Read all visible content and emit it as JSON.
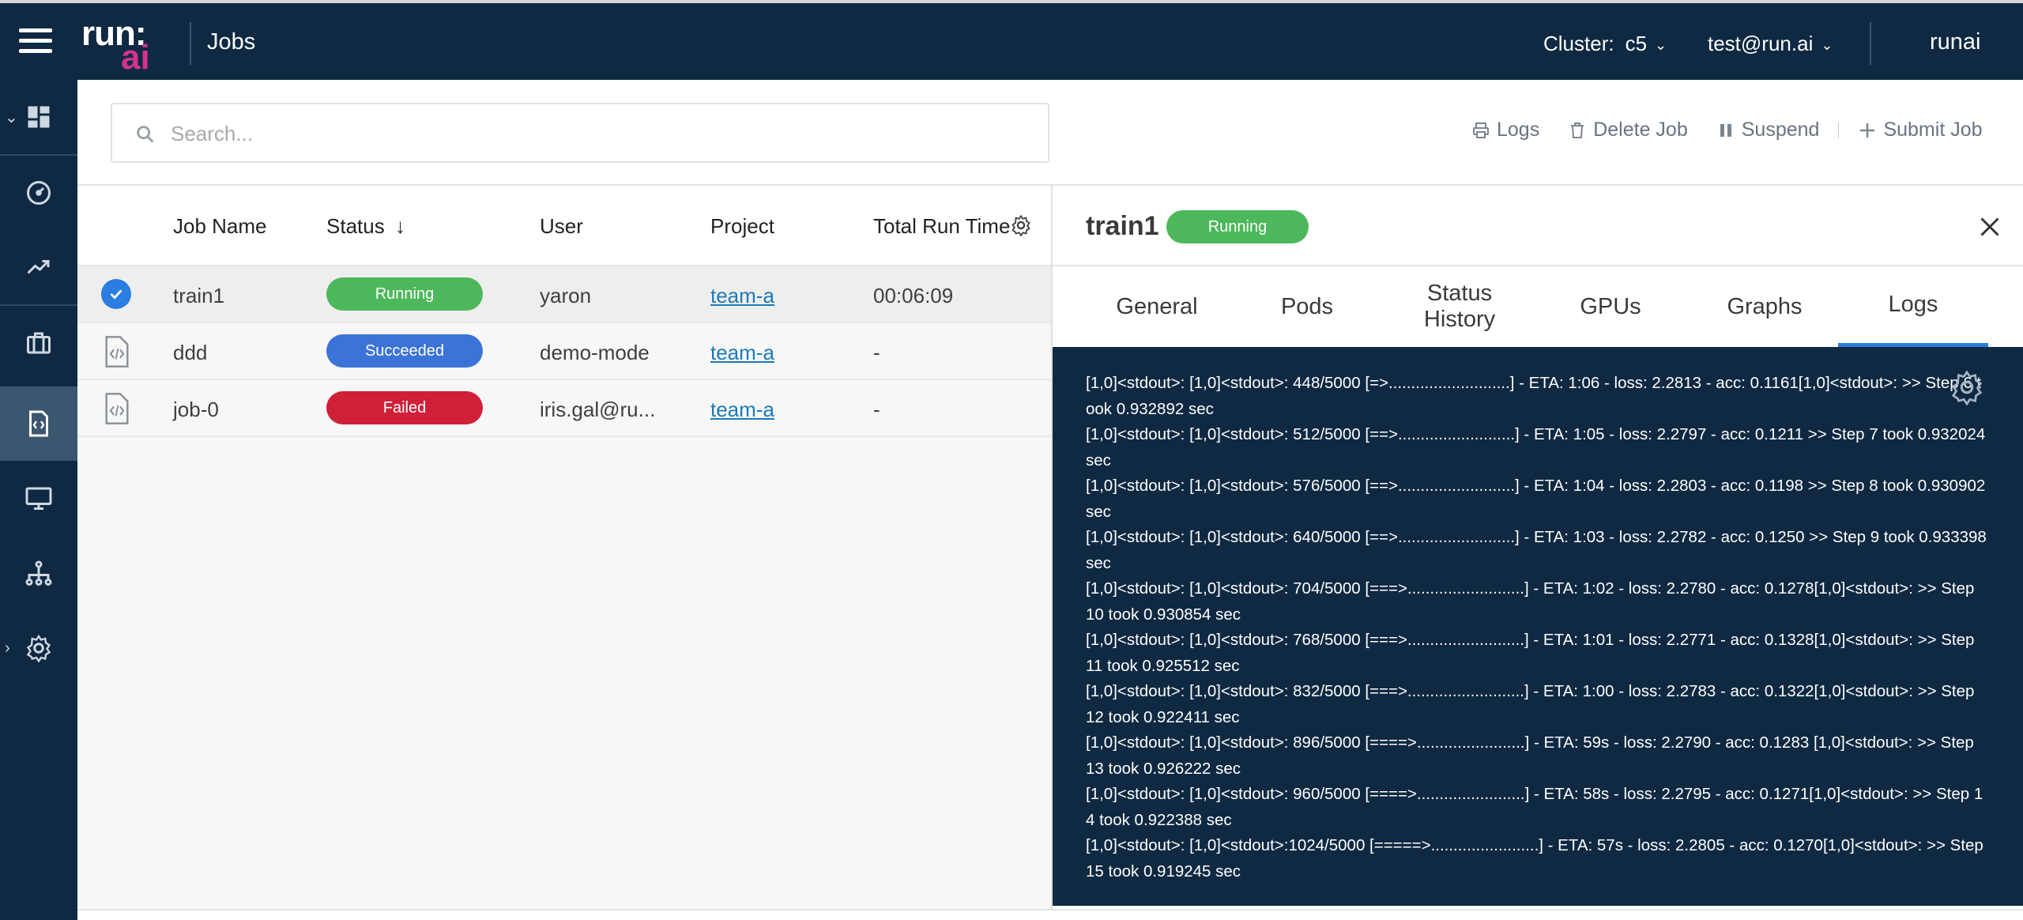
{
  "topbar": {
    "logo_top": "run:",
    "logo_bottom": "ai",
    "page_title": "Jobs",
    "cluster_label": "Cluster:",
    "cluster_value": "c5",
    "user_email": "test@run.ai",
    "tenant": "runai"
  },
  "search": {
    "placeholder": "Search..."
  },
  "actions": {
    "logs": "Logs",
    "delete": "Delete Job",
    "suspend": "Suspend",
    "submit": "Submit Job"
  },
  "table": {
    "headers": [
      "Job Name",
      "Status",
      "User",
      "Project",
      "Total Run Time"
    ],
    "rows": [
      {
        "name": "train1",
        "status": "Running",
        "user": "yaron",
        "project": "team-a",
        "runtime": "00:06:09"
      },
      {
        "name": "ddd",
        "status": "Succeeded",
        "user": "demo-mode",
        "project": "team-a",
        "runtime": "-"
      },
      {
        "name": "job-0",
        "status": "Failed",
        "user": "iris.gal@ru...",
        "project": "team-a",
        "runtime": "-"
      }
    ]
  },
  "panel": {
    "job_name": "train1",
    "status": "Running",
    "tabs": [
      "General",
      "Pods",
      "Status History",
      "GPUs",
      "Graphs",
      "Logs"
    ],
    "active_tab": "Logs",
    "logs": [
      "[1,0]<stdout>: [1,0]<stdout>: 448/5000 [=>...........................] - ETA: 1:06 - loss: 2.2813 - acc: 0.1161[1,0]<stdout>: >> Step 6 took 0.932892 sec",
      "[1,0]<stdout>: [1,0]<stdout>: 512/5000 [==>..........................] - ETA: 1:05 - loss: 2.2797 - acc: 0.1211 >> Step 7 took 0.932024 sec",
      "[1,0]<stdout>: [1,0]<stdout>: 576/5000 [==>..........................] - ETA: 1:04 - loss: 2.2803 - acc: 0.1198 >> Step 8 took 0.930902 sec",
      "[1,0]<stdout>: [1,0]<stdout>: 640/5000 [==>..........................] - ETA: 1:03 - loss: 2.2782 - acc: 0.1250 >> Step 9 took 0.933398 sec",
      "[1,0]<stdout>: [1,0]<stdout>: 704/5000 [===>..........................] - ETA: 1:02 - loss: 2.2780 - acc: 0.1278[1,0]<stdout>: >> Step 10 took 0.930854 sec",
      "[1,0]<stdout>: [1,0]<stdout>: 768/5000 [===>..........................] - ETA: 1:01 - loss: 2.2771 - acc: 0.1328[1,0]<stdout>: >> Step 11 took 0.925512 sec",
      "[1,0]<stdout>: [1,0]<stdout>: 832/5000 [===>..........................] - ETA: 1:00 - loss: 2.2783 - acc: 0.1322[1,0]<stdout>: >> Step 12 took 0.922411 sec",
      "[1,0]<stdout>: [1,0]<stdout>: 896/5000 [====>........................] - ETA: 59s - loss: 2.2790 - acc: 0.1283 [1,0]<stdout>: >> Step 13 took 0.926222 sec",
      "[1,0]<stdout>: [1,0]<stdout>: 960/5000 [====>........................] - ETA: 58s - loss: 2.2795 - acc: 0.1271[1,0]<stdout>: >> Step 14 took 0.922388 sec",
      "[1,0]<stdout>: [1,0]<stdout>:1024/5000 [=====>........................] - ETA: 57s - loss: 2.2805 - acc: 0.1270[1,0]<stdout>: >> Step 15 took 0.919245 sec"
    ]
  },
  "colors": {
    "nav_bg": "#0f2942",
    "accent": "#2a7de1",
    "running": "#4cb85b",
    "succeeded": "#3b73d6",
    "failed": "#cf2038",
    "logo_ai": "#d4328e"
  }
}
